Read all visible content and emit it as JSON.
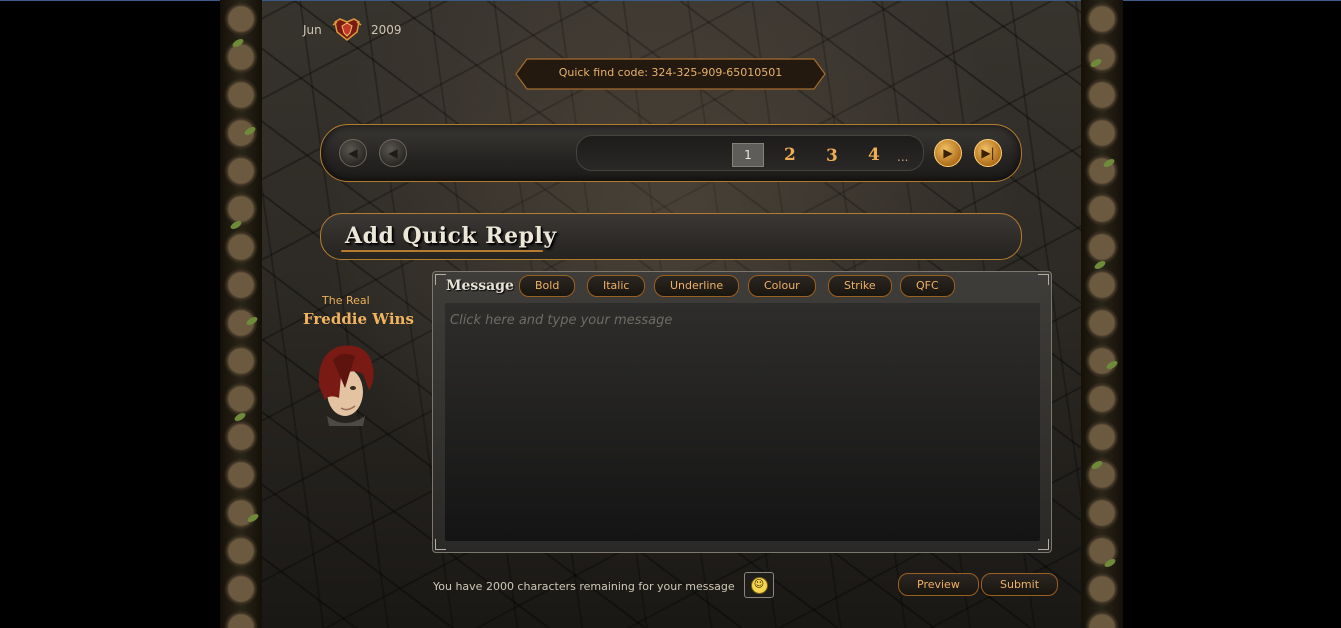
{
  "date": {
    "month": "Jun",
    "year": "2009"
  },
  "quick_find": {
    "text": "Quick find code: 324-325-909-65010501"
  },
  "pagination": {
    "pages": [
      "1",
      "2",
      "3",
      "4"
    ],
    "current": "1",
    "ellipsis": "..."
  },
  "quick_reply": {
    "title": "Add Quick Reply"
  },
  "author": {
    "prefix": "The Real",
    "name": "Freddie Wins"
  },
  "message": {
    "label": "Message",
    "placeholder": "Click here and type your message",
    "format_buttons": [
      "Bold",
      "Italic",
      "Underline",
      "Colour",
      "Strike",
      "QFC"
    ]
  },
  "footer": {
    "remaining_text": "You have 2000 characters remaining for your message",
    "preview_label": "Preview",
    "submit_label": "Submit"
  },
  "colors": {
    "accent": "#f0b060",
    "border": "#b57c30"
  }
}
